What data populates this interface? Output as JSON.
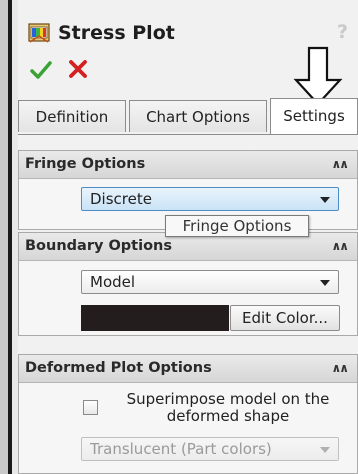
{
  "window": {
    "title": "Stress Plot",
    "help": "?"
  },
  "tabs": [
    {
      "label": "Definition",
      "active": false
    },
    {
      "label": "Chart Options",
      "active": false
    },
    {
      "label": "Settings",
      "active": true
    }
  ],
  "fringe_options": {
    "header": "Fringe Options",
    "selected": "Discrete",
    "tooltip": "Fringe Options"
  },
  "boundary_options": {
    "header": "Boundary Options",
    "selected": "Model",
    "swatch_color": "#231d1d",
    "edit_color_label": "Edit Color..."
  },
  "deformed_plot_options": {
    "header": "Deformed Plot Options",
    "superimpose_label": "Superimpose model on the deformed shape",
    "superimpose_checked": false,
    "display_selected": "Translucent (Part colors)",
    "display_enabled": false
  },
  "colors": {
    "ok_green": "#3aa335",
    "cancel_red": "#d42020",
    "panel_bg": "#f1f1f1",
    "focus_blue": "#4d8cc6"
  },
  "icons": {
    "title": "stress-plot-icon",
    "ok": "check-icon",
    "cancel": "x-icon",
    "collapse": "double-chevron-up-icon",
    "dropdown": "chevron-down-icon",
    "annotation": "down-arrow-icon"
  }
}
